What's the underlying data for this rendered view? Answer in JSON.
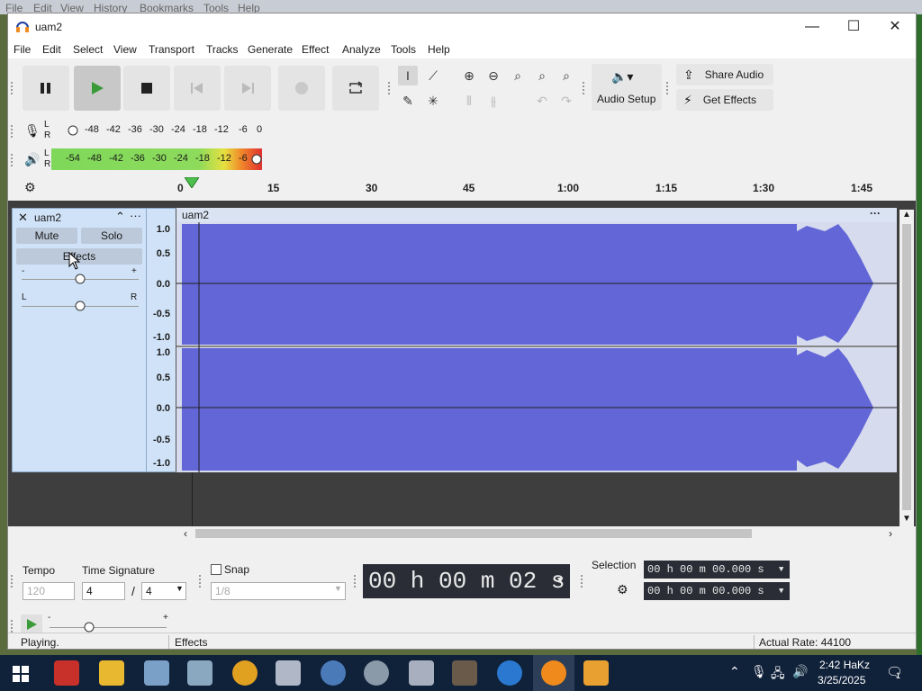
{
  "background_menu": [
    "File",
    "Edit",
    "View",
    "History",
    "Bookmarks",
    "Tools",
    "Help"
  ],
  "window": {
    "title": "uam2",
    "minimize": "—",
    "maximize": "☐",
    "close": "✕"
  },
  "menu": [
    "File",
    "Edit",
    "Select",
    "View",
    "Transport",
    "Tracks",
    "Generate",
    "Effect",
    "Analyze",
    "Tools",
    "Help"
  ],
  "toolbar": {
    "audio_setup": "Audio Setup",
    "share_audio": "Share Audio",
    "get_effects": "Get Effects"
  },
  "meters": {
    "record_channels": [
      "L",
      "R"
    ],
    "record_scale": [
      "-48",
      "-42",
      "-36",
      "-30",
      "-24",
      "-18",
      "-12",
      "-6",
      "0"
    ],
    "play_channels": [
      "L",
      "R"
    ],
    "play_scale": [
      "-54",
      "-48",
      "-42",
      "-36",
      "-30",
      "-24",
      "-18",
      "-12",
      "-6"
    ]
  },
  "ruler": {
    "ticks": [
      "0",
      "15",
      "30",
      "45",
      "1:00",
      "1:15",
      "1:30",
      "1:45"
    ]
  },
  "track": {
    "name": "uam2",
    "mute": "Mute",
    "solo": "Solo",
    "effects": "Effects",
    "gain_minus": "-",
    "gain_plus": "+",
    "pan_left": "L",
    "pan_right": "R",
    "scale_top": [
      "1.0",
      "0.5",
      "0.0",
      "-0.5",
      "-1.0"
    ],
    "scale_bottom": [
      "1.0",
      "0.5",
      "0.0",
      "-0.5",
      "-1.0"
    ],
    "clip_name": "uam2",
    "clip_menu": "···"
  },
  "bottom": {
    "tempo_label": "Tempo",
    "tempo_value": "120",
    "time_sig_label": "Time Signature",
    "time_sig_num": "4",
    "time_sig_sep": "/",
    "time_sig_den": "4",
    "snap_label": "Snap",
    "snap_value": "1/8",
    "time_display": "00 h 00 m 02 s",
    "selection_label": "Selection",
    "selection_start": "00 h 00 m 00.000 s",
    "selection_end": "00 h 00 m 00.000 s",
    "play_speed_minus": "-",
    "play_speed_plus": "+"
  },
  "status": {
    "left": "Playing.",
    "middle": "Effects",
    "right": "Actual Rate: 44100"
  },
  "taskbar": {
    "time": "2:42 HaKz",
    "date": "3/25/2025",
    "notif_count": "1"
  },
  "colors": {
    "waveform": "#6366d6",
    "track_bg": "#d0e2f7",
    "meter_green": "#7ed85a",
    "timecode_bg": "#2a2d36"
  }
}
